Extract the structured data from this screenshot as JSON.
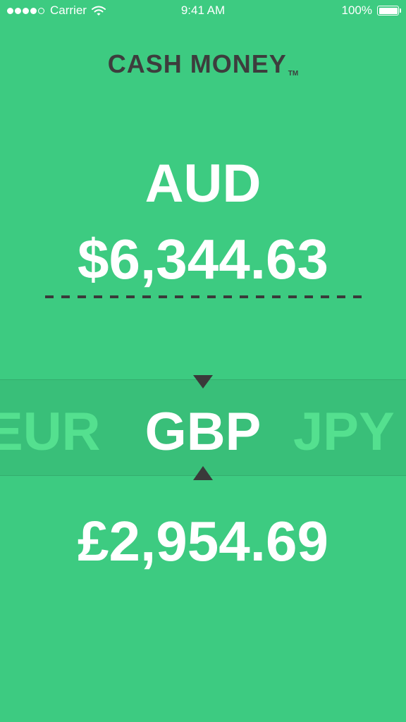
{
  "status_bar": {
    "carrier": "Carrier",
    "time": "9:41 AM",
    "battery": "100%",
    "signal_bars_filled": 4,
    "signal_bars_total": 5,
    "battery_level": 1.0
  },
  "app": {
    "title": "CASH MONEY",
    "trademark": "TM"
  },
  "source": {
    "currency_code": "AUD",
    "amount": "$6,344.63"
  },
  "picker": {
    "previous": "EUR",
    "selected": "GBP",
    "next": "JPY"
  },
  "target": {
    "amount": "£2,954.69"
  },
  "colors": {
    "background": "#3dcb81",
    "title_text": "#3d3d3d",
    "picker_band": "#39bf79",
    "faded_currency": "#54e08f",
    "indicator": "#3a3a3a"
  },
  "icons": [
    "signal-dots-icon",
    "wifi-icon",
    "battery-icon",
    "triangle-down-icon",
    "triangle-up-icon"
  ]
}
